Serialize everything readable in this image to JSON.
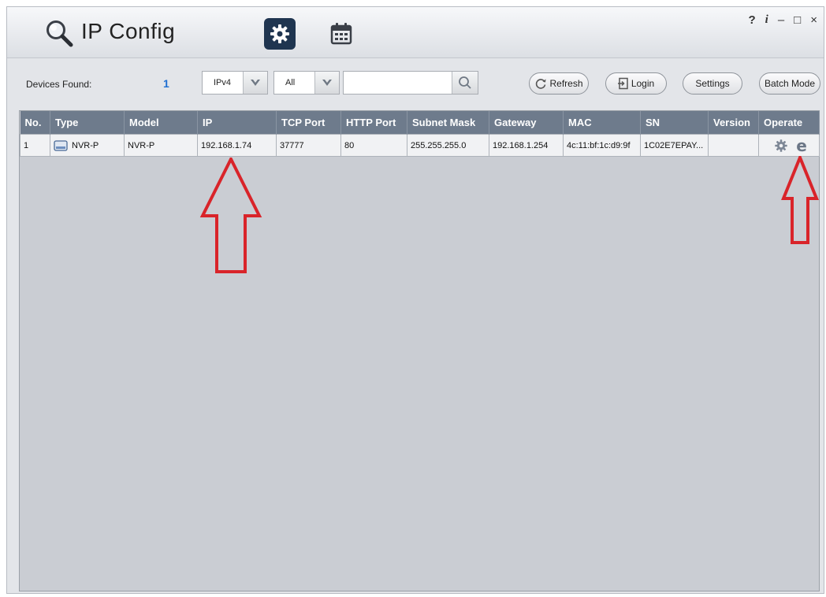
{
  "app": {
    "title": "IP Config"
  },
  "window_controls": {
    "help": "?",
    "info": "i",
    "minimize": "–",
    "maximize": "□",
    "close": "×"
  },
  "toolbar": {
    "devices_found_label": "Devices Found:",
    "devices_found_count": "1",
    "ip_version": "IPv4",
    "filter": "All",
    "search_value": "",
    "refresh_label": "Refresh",
    "login_label": "Login",
    "settings_label": "Settings",
    "batch_mode_label": "Batch Mode"
  },
  "table": {
    "columns": [
      "No.",
      "Type",
      "Model",
      "IP",
      "TCP Port",
      "HTTP Port",
      "Subnet Mask",
      "Gateway",
      "MAC",
      "SN",
      "Version",
      "Operate"
    ],
    "rows": [
      {
        "no": "1",
        "type": "NVR-P",
        "model": "NVR-P",
        "ip": "192.168.1.74",
        "tcp_port": "37777",
        "http_port": "80",
        "subnet_mask": "255.255.255.0",
        "gateway": "192.168.1.254",
        "mac": "4c:11:bf:1c:d9:9f",
        "sn": "1C02E7EPAY...",
        "version": ""
      }
    ]
  },
  "colors": {
    "header_bg": "#6e7b8c",
    "accent_blue": "#1f6fd1",
    "annotation_red": "#d9242a"
  }
}
